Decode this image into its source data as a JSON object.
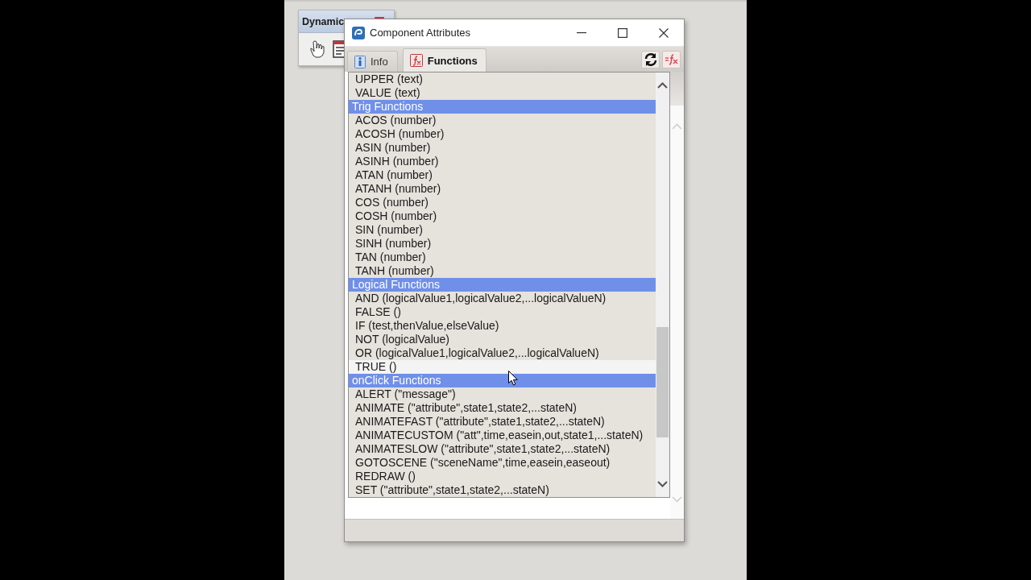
{
  "background_panel": {
    "title": "Dynamic"
  },
  "window": {
    "title": "Component Attributes"
  },
  "tabs": [
    {
      "label": "Info",
      "selected": false
    },
    {
      "label": "Functions",
      "selected": true
    }
  ],
  "function_list": {
    "items": [
      {
        "kind": "function",
        "label": "UPPER (text)",
        "hovered": false
      },
      {
        "kind": "function",
        "label": "VALUE (text)",
        "hovered": false
      },
      {
        "kind": "category",
        "label": "Trig Functions",
        "hovered": false
      },
      {
        "kind": "function",
        "label": "ACOS (number)",
        "hovered": false
      },
      {
        "kind": "function",
        "label": "ACOSH (number)",
        "hovered": false
      },
      {
        "kind": "function",
        "label": "ASIN (number)",
        "hovered": false
      },
      {
        "kind": "function",
        "label": "ASINH (number)",
        "hovered": false
      },
      {
        "kind": "function",
        "label": "ATAN (number)",
        "hovered": false
      },
      {
        "kind": "function",
        "label": "ATANH (number)",
        "hovered": false
      },
      {
        "kind": "function",
        "label": "COS (number)",
        "hovered": false
      },
      {
        "kind": "function",
        "label": "COSH (number)",
        "hovered": false
      },
      {
        "kind": "function",
        "label": "SIN (number)",
        "hovered": false
      },
      {
        "kind": "function",
        "label": "SINH (number)",
        "hovered": false
      },
      {
        "kind": "function",
        "label": "TAN (number)",
        "hovered": false
      },
      {
        "kind": "function",
        "label": "TANH (number)",
        "hovered": false
      },
      {
        "kind": "category",
        "label": "Logical Functions",
        "hovered": false
      },
      {
        "kind": "function",
        "label": "AND (logicalValue1,logicalValue2,...logicalValueN)",
        "hovered": false
      },
      {
        "kind": "function",
        "label": "FALSE ()",
        "hovered": false
      },
      {
        "kind": "function",
        "label": "IF (test,thenValue,elseValue)",
        "hovered": false
      },
      {
        "kind": "function",
        "label": "NOT (logicalValue)",
        "hovered": false
      },
      {
        "kind": "function",
        "label": "OR (logicalValue1,logicalValue2,...logicalValueN)",
        "hovered": false
      },
      {
        "kind": "function",
        "label": "TRUE ()",
        "hovered": true
      },
      {
        "kind": "category",
        "label": "onClick Functions",
        "hovered": false
      },
      {
        "kind": "function",
        "label": "ALERT (\"message\")",
        "hovered": false
      },
      {
        "kind": "function",
        "label": "ANIMATE (\"attribute\",state1,state2,...stateN)",
        "hovered": false
      },
      {
        "kind": "function",
        "label": "ANIMATEFAST (\"attribute\",state1,state2,...stateN)",
        "hovered": false
      },
      {
        "kind": "function",
        "label": "ANIMATECUSTOM (\"att\",time,easein,out,state1,...stateN)",
        "hovered": false
      },
      {
        "kind": "function",
        "label": "ANIMATESLOW (\"attribute\",state1,state2,...stateN)",
        "hovered": false
      },
      {
        "kind": "function",
        "label": "GOTOSCENE (\"sceneName\",time,easein,easeout)",
        "hovered": false
      },
      {
        "kind": "function",
        "label": "REDRAW ()",
        "hovered": false
      },
      {
        "kind": "function",
        "label": "SET (\"attribute\",state1,state2,...stateN)",
        "hovered": false
      }
    ]
  }
}
